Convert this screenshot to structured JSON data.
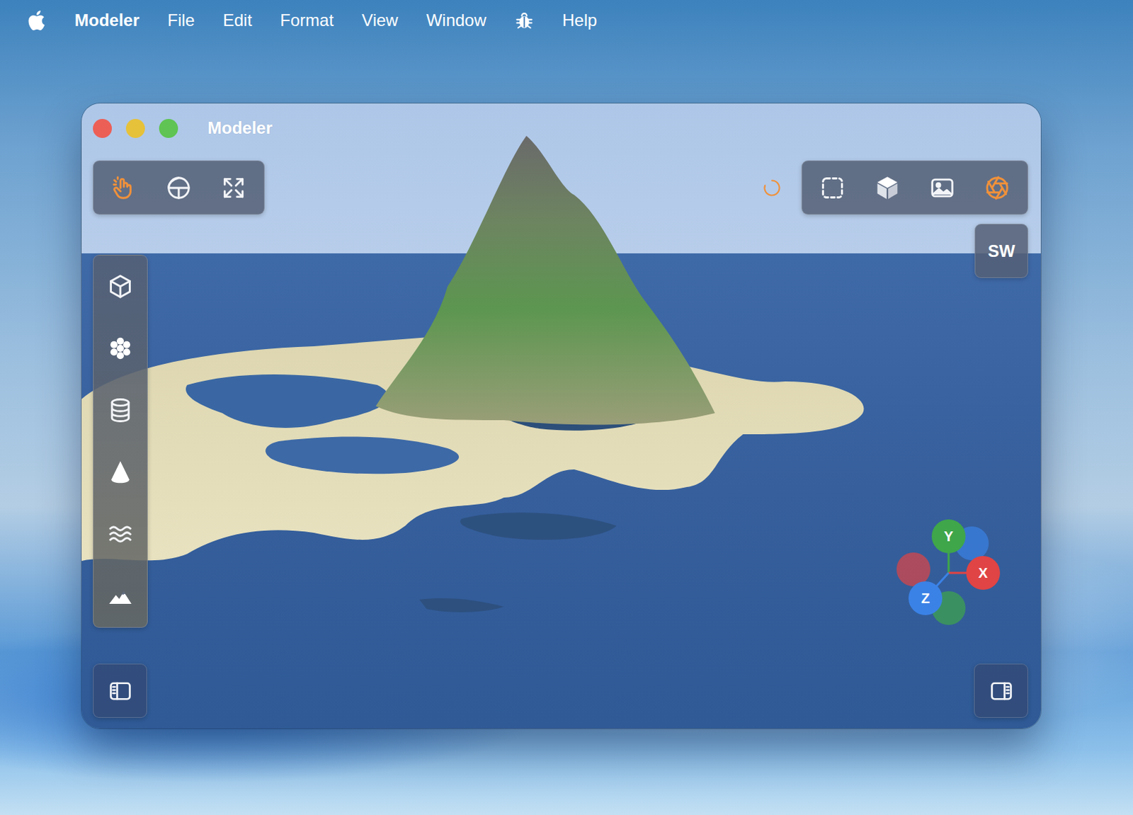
{
  "menubar": {
    "app": "Modeler",
    "items": [
      {
        "kind": "text",
        "label": "File"
      },
      {
        "kind": "text",
        "label": "Edit"
      },
      {
        "kind": "text",
        "label": "Format"
      },
      {
        "kind": "text",
        "label": "View"
      },
      {
        "kind": "text",
        "label": "Window"
      },
      {
        "kind": "icon",
        "label": ""
      },
      {
        "kind": "text",
        "label": "Help"
      }
    ]
  },
  "window": {
    "title": "Modeler"
  },
  "tools": [
    {
      "selected": true
    },
    {
      "selected": false
    },
    {
      "selected": false
    }
  ],
  "render": {
    "loading": true,
    "modes": [
      {
        "selected": false
      },
      {
        "selected": false
      },
      {
        "selected": false
      },
      {
        "selected": true
      }
    ]
  },
  "view_button": "SW",
  "gizmo": {
    "axes": [
      {
        "label": "Y",
        "color": "#3fa64a"
      },
      {
        "label": "X",
        "color": "#e04444"
      },
      {
        "label": "Z",
        "color": "#3b82e6"
      }
    ]
  }
}
